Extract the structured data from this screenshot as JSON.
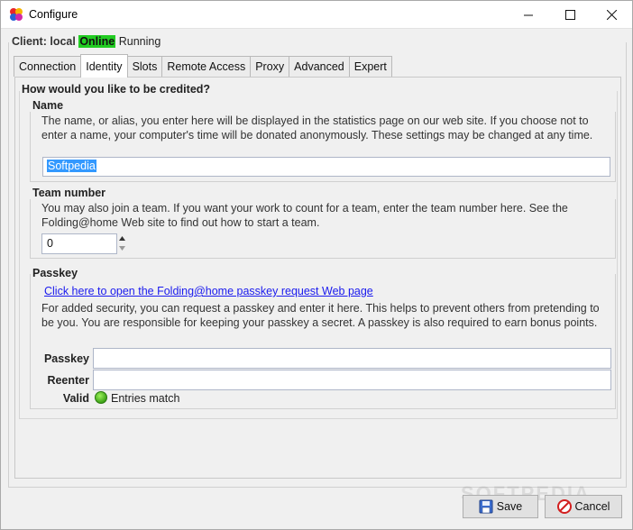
{
  "window": {
    "title": "Configure"
  },
  "client": {
    "label": "Client: local",
    "status": "Online",
    "state": "Running",
    "status_color": "#22cc22"
  },
  "tabs": [
    {
      "label": "Connection",
      "active": false
    },
    {
      "label": "Identity",
      "active": true
    },
    {
      "label": "Slots",
      "active": false
    },
    {
      "label": "Remote Access",
      "active": false
    },
    {
      "label": "Proxy",
      "active": false
    },
    {
      "label": "Advanced",
      "active": false
    },
    {
      "label": "Expert",
      "active": false
    }
  ],
  "identity": {
    "heading": "How would you like to be credited?",
    "name": {
      "title": "Name",
      "description": "The name, or alias, you enter here will be displayed in the statistics page on our web site.  If you choose not to enter a name, your computer's time will be donated anonymously.  These settings may be changed at any time.",
      "value": "Softpedia"
    },
    "team": {
      "title": "Team number",
      "description": "You may also join a team.  If you want your work to count for a team, enter the team number here.  See the Folding@home Web site to find out how to start a team.",
      "value": "0"
    },
    "passkey": {
      "title": "Passkey",
      "link_text": "Click here to open the Folding@home passkey request Web page",
      "description": "For added security, you can request a passkey and enter it here.  This helps to prevent others from pretending to be you.  You are responsible for keeping your passkey a secret.  A passkey is also required to earn bonus points.",
      "passkey_label": "Passkey",
      "passkey_value": "",
      "reenter_label": "Reenter",
      "reenter_value": "",
      "valid_label": "Valid",
      "valid_text": "Entries match",
      "valid_color": "#3ea318"
    }
  },
  "buttons": {
    "save": "Save",
    "cancel": "Cancel"
  },
  "watermark": "SOFTPEDIA"
}
